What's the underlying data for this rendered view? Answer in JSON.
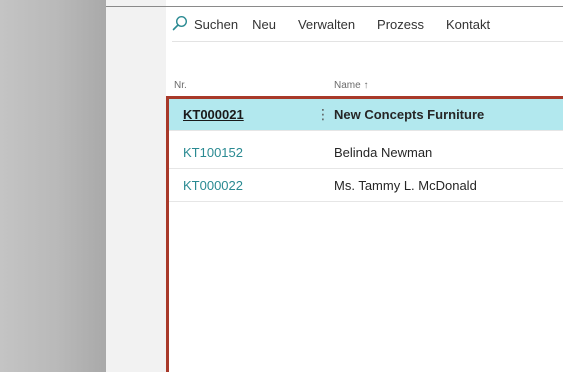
{
  "toolbar": {
    "search_icon": "search-icon",
    "search_label": "Suchen",
    "new_label": "Neu",
    "manage_label": "Verwalten",
    "process_label": "Prozess",
    "contact_label": "Kontakt"
  },
  "columns": {
    "no": "Nr.",
    "name": "Name",
    "name_sort_indicator": "↑"
  },
  "rows": [
    {
      "no": "KT000021",
      "menu": "⋮",
      "name": "New Concepts Furniture",
      "selected": true
    },
    {
      "no": "KT100152",
      "name": "Belinda Newman",
      "selected": false
    },
    {
      "no": "KT000022",
      "name": "Ms. Tammy L. McDonald",
      "selected": false
    }
  ],
  "colors": {
    "accent_teal": "#2a8a92",
    "selected_row": "#b2e8ee",
    "frame_border": "#a8392a"
  }
}
